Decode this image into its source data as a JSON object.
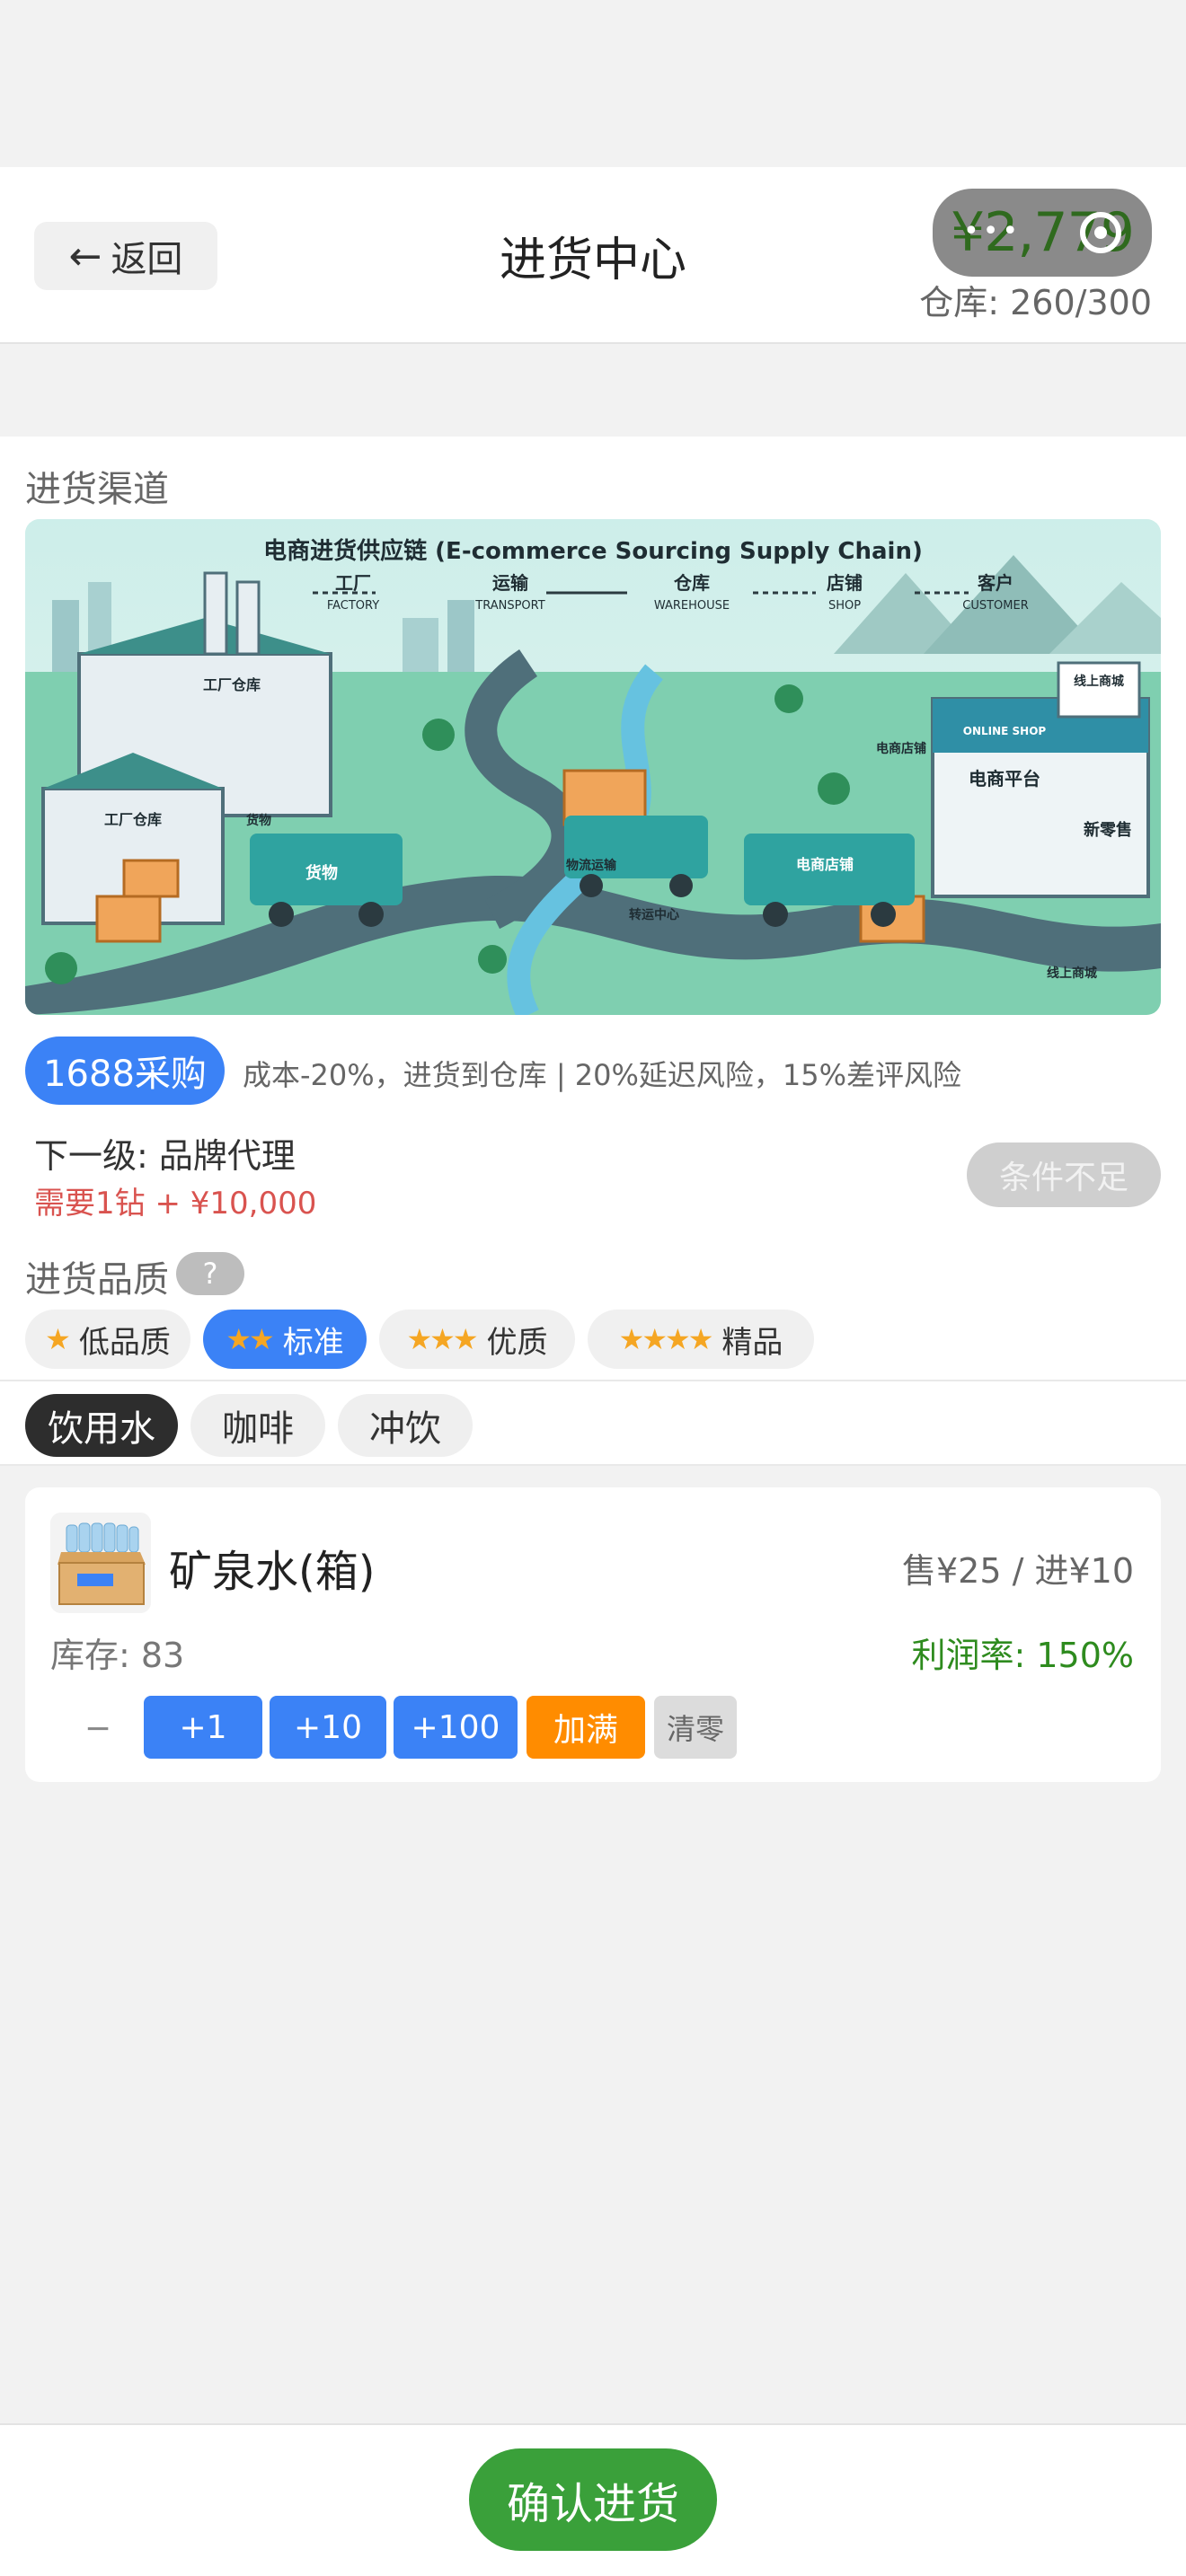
{
  "header": {
    "back_label": "返回",
    "title": "进货中心",
    "money": "¥2,779",
    "warehouse": "仓库: 260/300"
  },
  "channel": {
    "section_label": "进货渠道",
    "banner": {
      "title": "电商进货供应链 (E-commerce Sourcing Supply Chain)",
      "steps": [
        {
          "cn": "工厂",
          "en": "FACTORY"
        },
        {
          "cn": "运输",
          "en": "TRANSPORT"
        },
        {
          "cn": "仓库",
          "en": "WAREHOUSE"
        },
        {
          "cn": "店铺",
          "en": "SHOP"
        },
        {
          "cn": "客户",
          "en": "CUSTOMER"
        }
      ],
      "labels": {
        "factory": "工厂仓库",
        "goods": "货物",
        "logistics": "物流运输",
        "transit": "转运中心",
        "shop_sign": "电商店铺",
        "platform": "电商平台",
        "new_retail": "新零售",
        "online_shop": "ONLINE SHOP",
        "online_store": "线上商城"
      }
    },
    "name": "1688采购",
    "description": "成本-20%，进货到仓库 | 20%延迟风险，15%差评风险",
    "next_level": "下一级: 品牌代理",
    "requirement": "需要1钻 + ¥10,000",
    "condition_label": "条件不足"
  },
  "quality": {
    "section_label": "进货品质",
    "help": "?",
    "options": [
      {
        "stars": "★",
        "label": "低品质"
      },
      {
        "stars": "★★",
        "label": "标准"
      },
      {
        "stars": "★★★",
        "label": "优质"
      },
      {
        "stars": "★★★★",
        "label": "精品"
      }
    ],
    "selected": "标准"
  },
  "categories": [
    "饮用水",
    "咖啡",
    "冲饮"
  ],
  "selected_category": "饮用水",
  "products": [
    {
      "name": "矿泉水(箱)",
      "price_line": "售¥25 / 进¥10",
      "stock": "库存: 83",
      "profit": "利润率: 150%",
      "actions": [
        "−",
        "+1",
        "+10",
        "+100",
        "加满",
        "清零"
      ]
    }
  ],
  "footer": {
    "confirm_label": "确认进货"
  },
  "colors": {
    "accent": "#3b82f6",
    "fill": "#ff8c00",
    "confirm": "#3aa03a",
    "profit": "#2e8b1e",
    "requirement": "#d9534f",
    "star": "#f5a623"
  }
}
